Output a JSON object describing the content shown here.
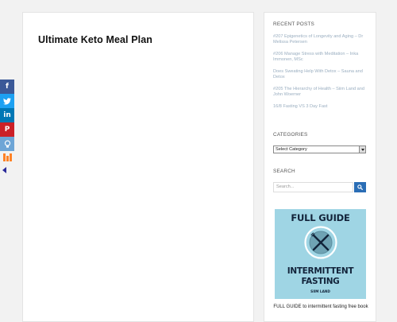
{
  "article": {
    "title": "Ultimate Keto Meal Plan"
  },
  "share": {
    "facebook": "f",
    "twitter": "t",
    "linkedin": "in",
    "pinterest": "P"
  },
  "sidebar": {
    "recent_posts": {
      "title": "RECENT POSTS",
      "items": [
        "#207 Epigenetics of Longevity and Aging – Dr Melissa Petersen",
        "#206 Manage Stress with Meditation – Inka Immonen, MSc",
        "Does Sweating Help With Detox – Sauna and Detox",
        "#205 The Hierarchy of Health – Siim Land and John Woerner",
        "16/8 Fasting VS 3 Day Fast"
      ]
    },
    "categories": {
      "title": "CATEGORIES",
      "selected": "Select Category"
    },
    "search": {
      "title": "SEARCH",
      "placeholder": "Search..."
    },
    "promo": {
      "line1": "FULL GUIDE",
      "line2": "INTERMITTENT",
      "line3": "FASTING",
      "author": "SIIM LAND",
      "caption": "FULL GUIDE to intermittent fasting free book"
    }
  },
  "colors": {
    "search_button": "#2a6db5",
    "link": "#9aaec0",
    "promo_bg": "#9fd5e4",
    "promo_ink": "#12233a"
  }
}
